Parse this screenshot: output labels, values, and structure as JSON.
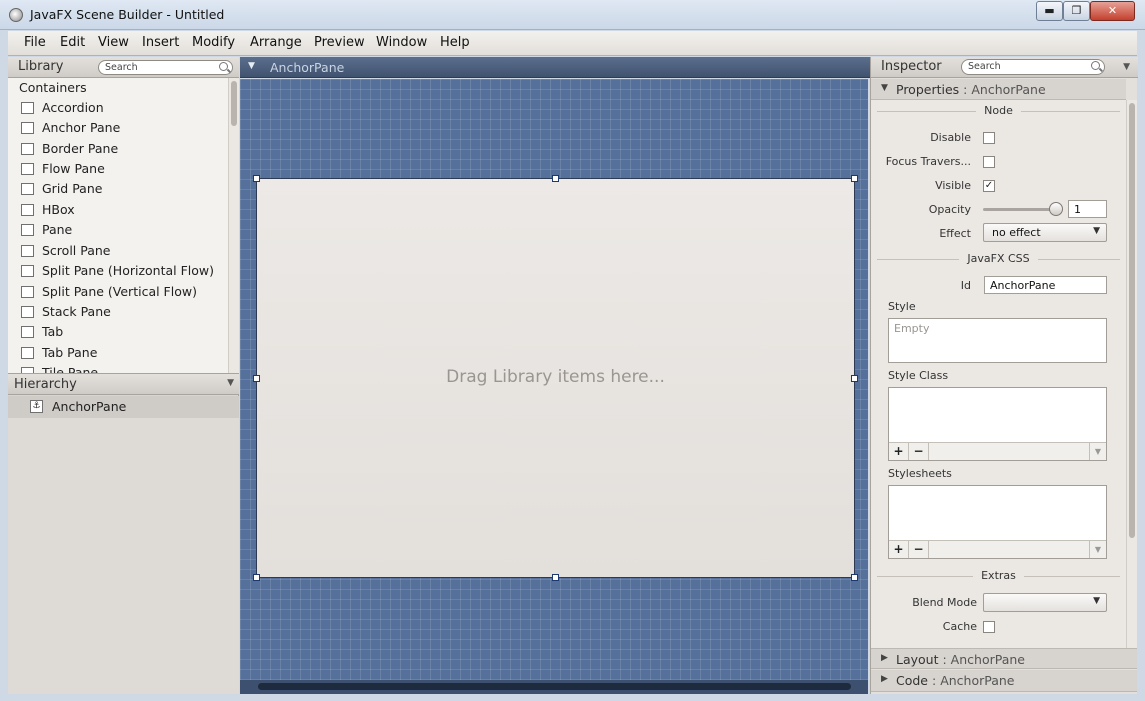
{
  "window": {
    "title": "JavaFX Scene Builder - Untitled",
    "min": "▬",
    "max": "❐",
    "close": "✕"
  },
  "menu": [
    "File",
    "Edit",
    "View",
    "Insert",
    "Modify",
    "Arrange",
    "Preview",
    "Window",
    "Help"
  ],
  "library": {
    "title": "Library",
    "search_placeholder": "Search",
    "category": "Containers",
    "items": [
      "Accordion",
      "Anchor Pane",
      "Border Pane",
      "Flow Pane",
      "Grid Pane",
      "HBox",
      "Pane",
      "Scroll Pane",
      "Split Pane (Horizontal Flow)",
      "Split Pane (Vertical Flow)",
      "Stack Pane",
      "Tab",
      "Tab Pane",
      "Tile Pane"
    ]
  },
  "hierarchy": {
    "title": "Hierarchy",
    "items": [
      "AnchorPane"
    ]
  },
  "canvas": {
    "breadcrumb": "AnchorPane",
    "hint": "Drag Library items here..."
  },
  "inspector": {
    "title": "Inspector",
    "search_placeholder": "Search",
    "properties_section": "Properties",
    "properties_target": "AnchorPane",
    "separator": " : ",
    "node_group": "Node",
    "disable_label": "Disable",
    "disable_checked": false,
    "focus_label": "Focus Travers...",
    "focus_checked": false,
    "visible_label": "Visible",
    "visible_checked": true,
    "check_mark": "✓",
    "opacity_label": "Opacity",
    "opacity_value": "1",
    "effect_label": "Effect",
    "effect_value": "no effect",
    "css_group": "JavaFX CSS",
    "id_label": "Id",
    "id_value": "AnchorPane",
    "style_label": "Style",
    "style_placeholder": "Empty",
    "style_class_label": "Style Class",
    "stylesheets_label": "Stylesheets",
    "plus": "+",
    "minus": "−",
    "extras_group": "Extras",
    "blend_label": "Blend Mode",
    "blend_value": "",
    "cache_label": "Cache",
    "cache_checked": false,
    "layout_section": "Layout",
    "layout_target": "AnchorPane",
    "code_section": "Code",
    "code_target": "AnchorPane"
  }
}
